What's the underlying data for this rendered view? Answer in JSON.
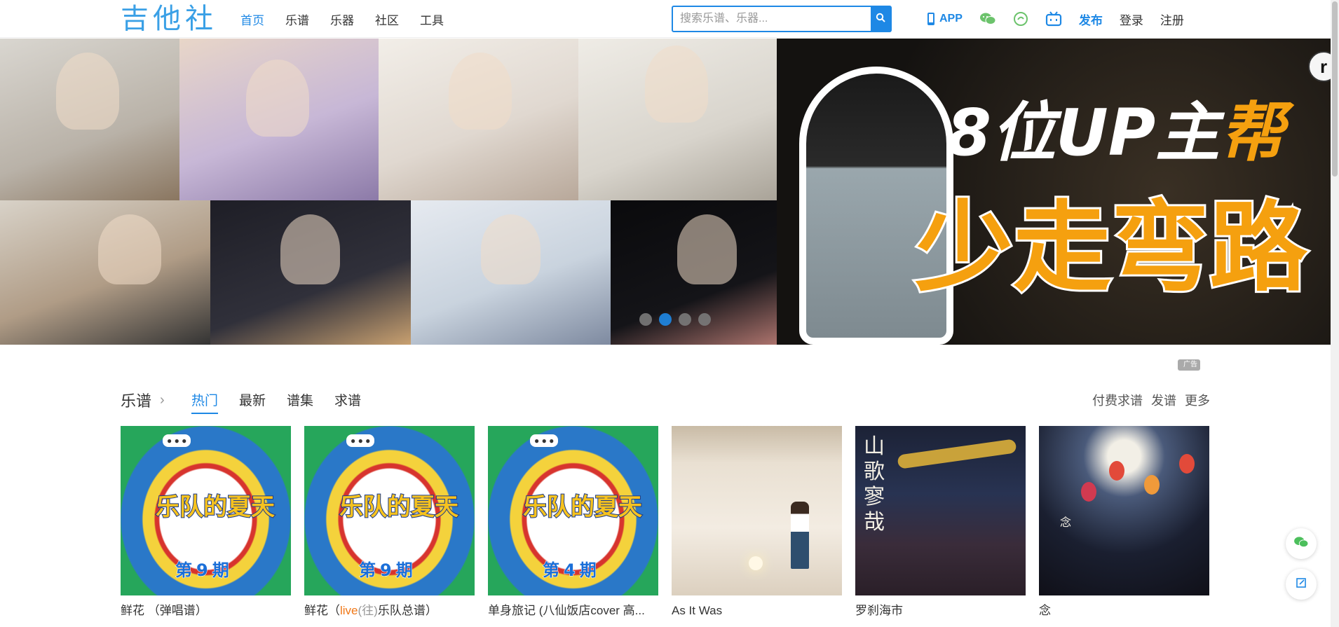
{
  "header": {
    "logo": "吉他社",
    "nav": [
      {
        "label": "首页",
        "active": true
      },
      {
        "label": "乐谱",
        "active": false
      },
      {
        "label": "乐器",
        "active": false
      },
      {
        "label": "社区",
        "active": false
      },
      {
        "label": "工具",
        "active": false
      }
    ],
    "search": {
      "placeholder": "搜索乐谱、乐器..."
    },
    "app_label": "APP",
    "publish_label": "发布",
    "login_label": "登录",
    "register_label": "注册"
  },
  "banner": {
    "line1_main": "8位UP主",
    "line1_highlight": "帮",
    "line2": "少走弯路",
    "corner_glyph": "r",
    "dots_count": 4,
    "active_dot": 1
  },
  "ad_tag": "广告",
  "section": {
    "title": "乐谱",
    "tabs": [
      {
        "label": "热门",
        "active": true
      },
      {
        "label": "最新",
        "active": false
      },
      {
        "label": "谱集",
        "active": false
      },
      {
        "label": "求谱",
        "active": false
      }
    ],
    "links": [
      "付费求谱",
      "发谱",
      "更多"
    ]
  },
  "cards": [
    {
      "cover": "band",
      "cover_text": "乐队的夏天",
      "episode": "第9期",
      "title": "鲜花 （弹唱谱）"
    },
    {
      "cover": "band",
      "cover_text": "乐队的夏天",
      "episode": "第9期",
      "title_parts": [
        "鲜花（",
        "live",
        "(往)",
        "乐队总谱）"
      ]
    },
    {
      "cover": "band",
      "cover_text": "乐队的夏天",
      "episode": "第4期",
      "title": "单身旅记 (八仙饭店cover 高..."
    },
    {
      "cover": "room",
      "title": "As It Was"
    },
    {
      "cover": "dragon",
      "cover_text": "山歌寥哉",
      "title": "罗刹海市"
    },
    {
      "cover": "balloon",
      "cover_text": "念",
      "title": "念"
    }
  ],
  "colors": {
    "accent": "#1e88e5",
    "highlight": "#f5a00f",
    "orange_text": "#f07818"
  }
}
